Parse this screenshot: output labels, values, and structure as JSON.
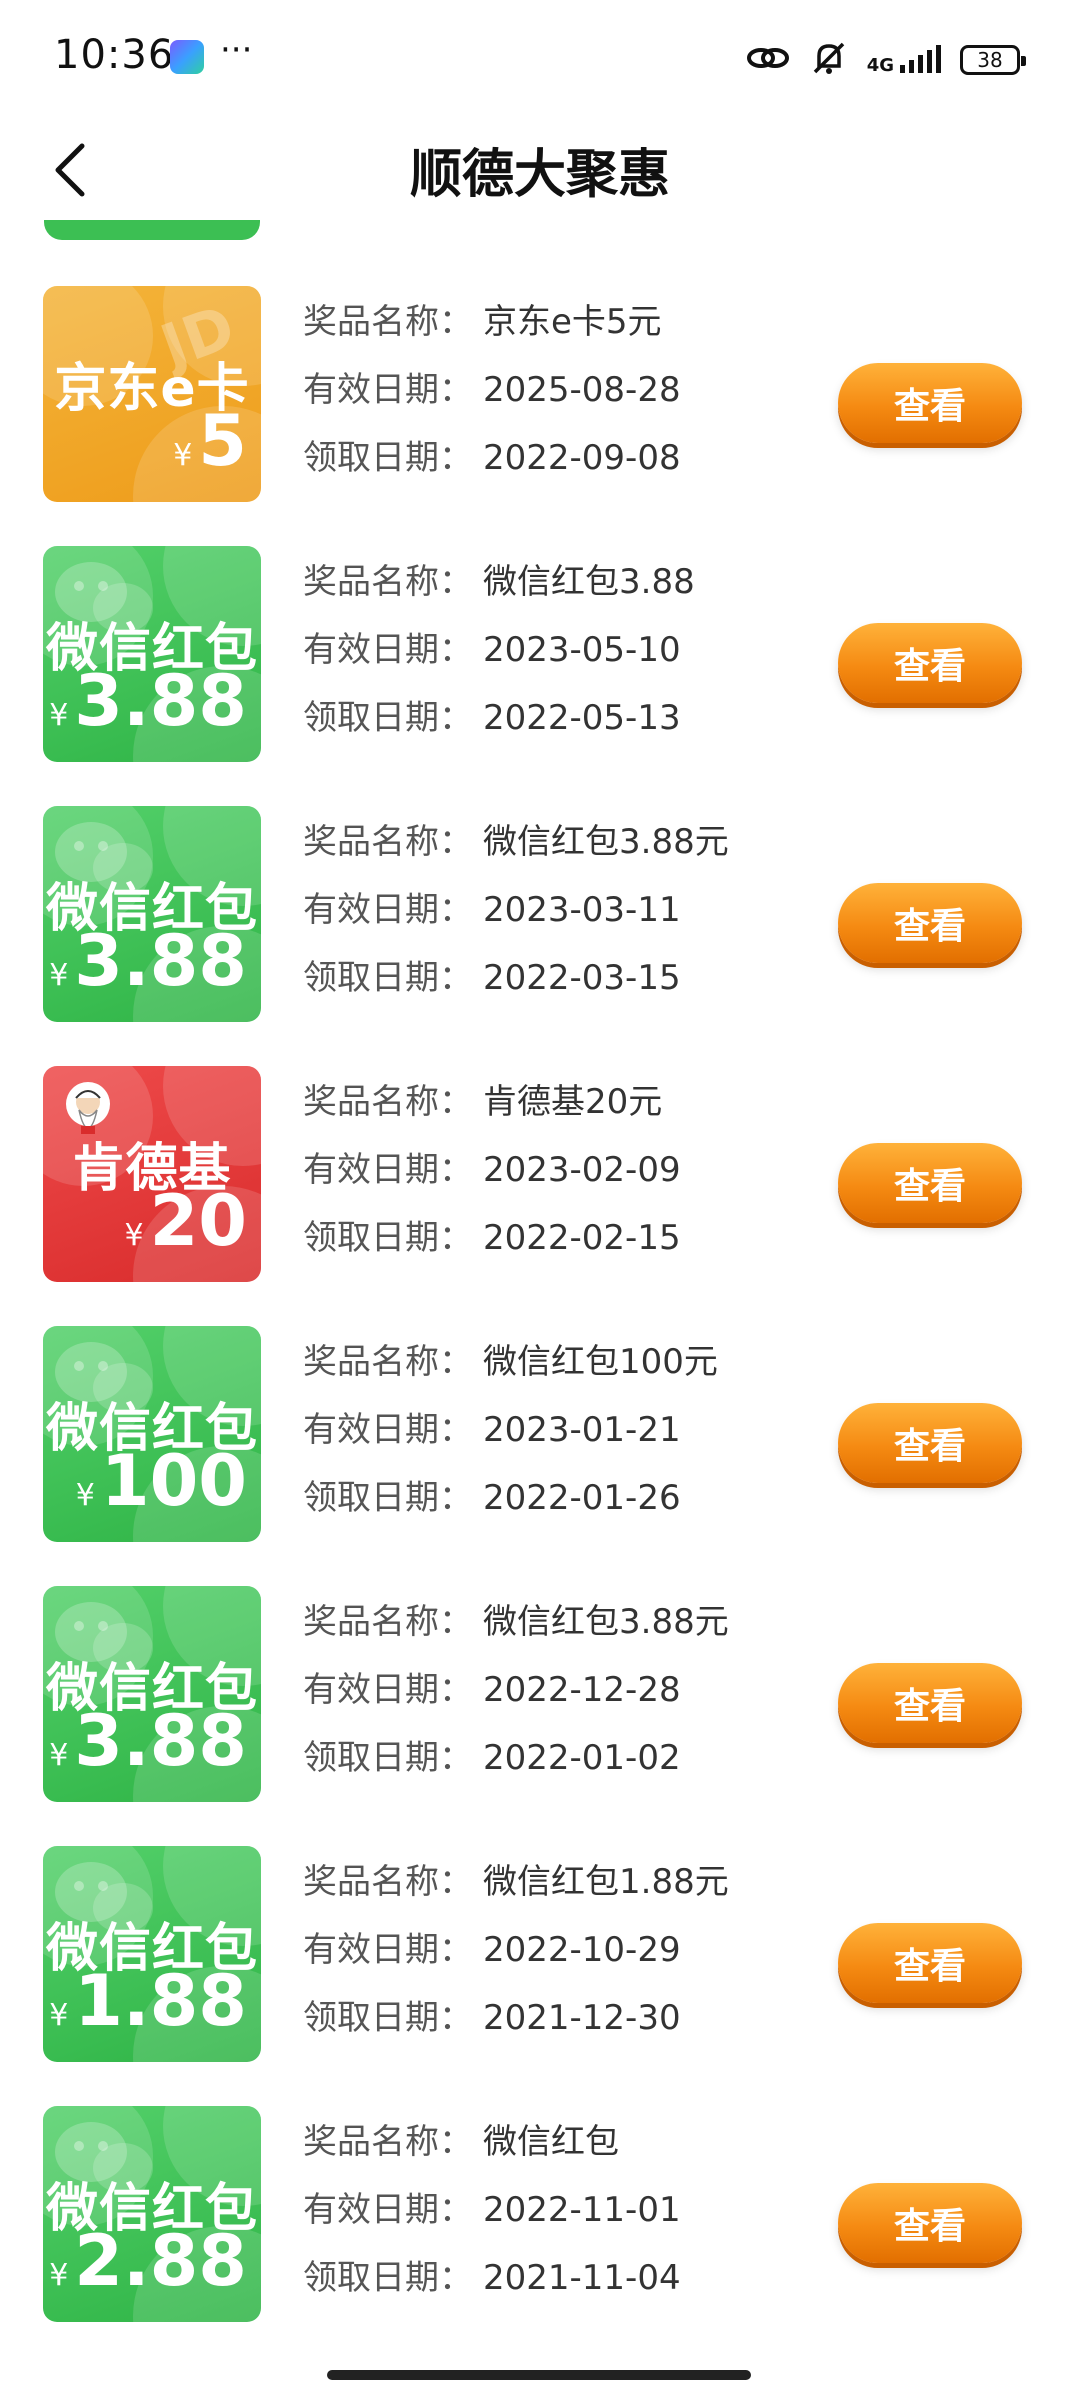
{
  "status_bar": {
    "time": "10:36",
    "dots": "···",
    "network": "4G",
    "battery": "38"
  },
  "header": {
    "title": "顺德大聚惠"
  },
  "labels": {
    "name": "奖品名称：",
    "valid": "有效日期：",
    "received": "领取日期：",
    "view_button": "查看"
  },
  "colors": {
    "wechat_green": "#3cbf53",
    "jd_orange": "#f0a224",
    "kfc_red": "#e23a3a",
    "button_orange": "#f58a12"
  },
  "prizes": [
    {
      "card_color": "orange",
      "card_name": "京东e卡",
      "card_yen": "¥",
      "card_amount": "5",
      "name": "京东e卡5元",
      "valid_date": "2025-08-28",
      "received_date": "2022-09-08",
      "icon": "jd-logo-icon"
    },
    {
      "card_color": "green",
      "card_name": "微信红包",
      "card_yen": "¥",
      "card_amount": "3.88",
      "name": "微信红包3.88",
      "valid_date": "2023-05-10",
      "received_date": "2022-05-13",
      "icon": "wechat-icon"
    },
    {
      "card_color": "green",
      "card_name": "微信红包",
      "card_yen": "¥",
      "card_amount": "3.88",
      "name": "微信红包3.88元",
      "valid_date": "2023-03-11",
      "received_date": "2022-03-15",
      "icon": "wechat-icon"
    },
    {
      "card_color": "red",
      "card_name": "肯德基",
      "card_yen": "¥",
      "card_amount": "20",
      "name": "肯德基20元",
      "valid_date": "2023-02-09",
      "received_date": "2022-02-15",
      "icon": "kfc-logo-icon"
    },
    {
      "card_color": "green",
      "card_name": "微信红包",
      "card_yen": "¥",
      "card_amount": "100",
      "name": "微信红包100元",
      "valid_date": "2023-01-21",
      "received_date": "2022-01-26",
      "icon": "wechat-icon"
    },
    {
      "card_color": "green",
      "card_name": "微信红包",
      "card_yen": "¥",
      "card_amount": "3.88",
      "name": "微信红包3.88元",
      "valid_date": "2022-12-28",
      "received_date": "2022-01-02",
      "icon": "wechat-icon"
    },
    {
      "card_color": "green",
      "card_name": "微信红包",
      "card_yen": "¥",
      "card_amount": "1.88",
      "name": "微信红包1.88元",
      "valid_date": "2022-10-29",
      "received_date": "2021-12-30",
      "icon": "wechat-icon"
    },
    {
      "card_color": "green",
      "card_name": "微信红包",
      "card_yen": "¥",
      "card_amount": "2.88",
      "name": "微信红包",
      "valid_date": "2022-11-01",
      "received_date": "2021-11-04",
      "icon": "wechat-icon"
    }
  ]
}
